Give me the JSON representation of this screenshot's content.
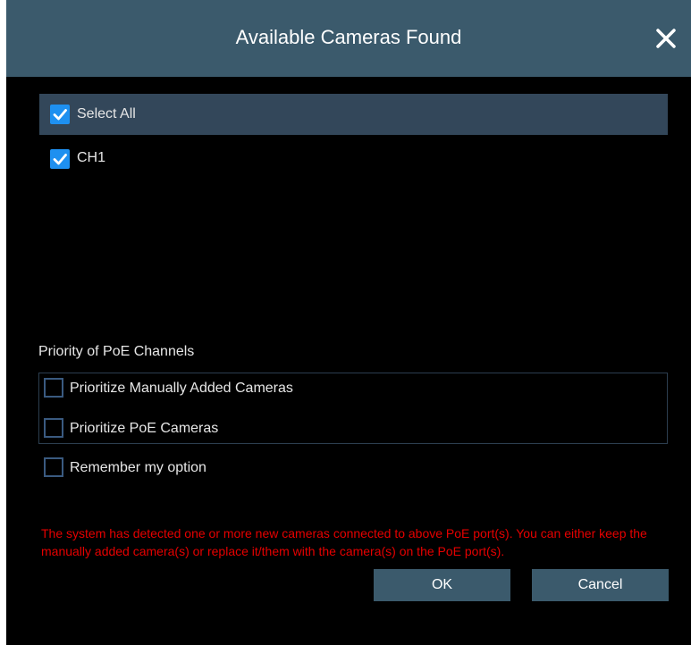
{
  "dialog": {
    "title": "Available Cameras Found",
    "close_icon": "close-icon"
  },
  "camera_list": {
    "select_all": {
      "label": "Select All",
      "checked": true
    },
    "channels": [
      {
        "label": "CH1",
        "checked": true
      }
    ]
  },
  "poe_priority": {
    "section_label": "Priority of PoE Channels",
    "options": [
      {
        "label": "Prioritize Manually Added Cameras",
        "checked": false
      },
      {
        "label": "Prioritize PoE Cameras",
        "checked": false
      }
    ],
    "remember": {
      "label": "Remember my option",
      "checked": false
    }
  },
  "warning_text": "The system has detected one or more new cameras connected to above PoE port(s). You can either keep the manually added camera(s) or replace it/them with the camera(s) on the PoE port(s).",
  "buttons": {
    "ok_label": "OK",
    "cancel_label": "Cancel"
  },
  "colors": {
    "titlebar": "#3b5a6c",
    "background": "#000000",
    "selected_row": "#33475a",
    "checkbox_checked": "#1e90f0",
    "warning": "#e60000"
  }
}
